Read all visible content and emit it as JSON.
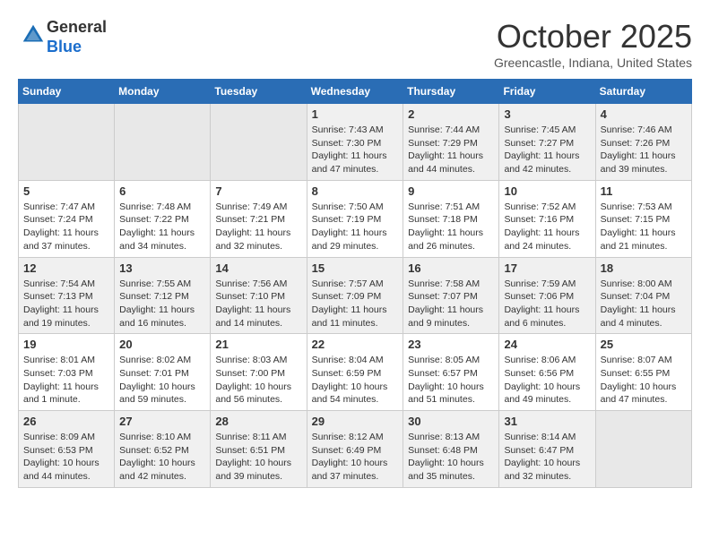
{
  "header": {
    "logo_line1": "General",
    "logo_line2": "Blue",
    "month": "October 2025",
    "location": "Greencastle, Indiana, United States"
  },
  "weekdays": [
    "Sunday",
    "Monday",
    "Tuesday",
    "Wednesday",
    "Thursday",
    "Friday",
    "Saturday"
  ],
  "weeks": [
    [
      {
        "day": "",
        "info": ""
      },
      {
        "day": "",
        "info": ""
      },
      {
        "day": "",
        "info": ""
      },
      {
        "day": "1",
        "info": "Sunrise: 7:43 AM\nSunset: 7:30 PM\nDaylight: 11 hours\nand 47 minutes."
      },
      {
        "day": "2",
        "info": "Sunrise: 7:44 AM\nSunset: 7:29 PM\nDaylight: 11 hours\nand 44 minutes."
      },
      {
        "day": "3",
        "info": "Sunrise: 7:45 AM\nSunset: 7:27 PM\nDaylight: 11 hours\nand 42 minutes."
      },
      {
        "day": "4",
        "info": "Sunrise: 7:46 AM\nSunset: 7:26 PM\nDaylight: 11 hours\nand 39 minutes."
      }
    ],
    [
      {
        "day": "5",
        "info": "Sunrise: 7:47 AM\nSunset: 7:24 PM\nDaylight: 11 hours\nand 37 minutes."
      },
      {
        "day": "6",
        "info": "Sunrise: 7:48 AM\nSunset: 7:22 PM\nDaylight: 11 hours\nand 34 minutes."
      },
      {
        "day": "7",
        "info": "Sunrise: 7:49 AM\nSunset: 7:21 PM\nDaylight: 11 hours\nand 32 minutes."
      },
      {
        "day": "8",
        "info": "Sunrise: 7:50 AM\nSunset: 7:19 PM\nDaylight: 11 hours\nand 29 minutes."
      },
      {
        "day": "9",
        "info": "Sunrise: 7:51 AM\nSunset: 7:18 PM\nDaylight: 11 hours\nand 26 minutes."
      },
      {
        "day": "10",
        "info": "Sunrise: 7:52 AM\nSunset: 7:16 PM\nDaylight: 11 hours\nand 24 minutes."
      },
      {
        "day": "11",
        "info": "Sunrise: 7:53 AM\nSunset: 7:15 PM\nDaylight: 11 hours\nand 21 minutes."
      }
    ],
    [
      {
        "day": "12",
        "info": "Sunrise: 7:54 AM\nSunset: 7:13 PM\nDaylight: 11 hours\nand 19 minutes."
      },
      {
        "day": "13",
        "info": "Sunrise: 7:55 AM\nSunset: 7:12 PM\nDaylight: 11 hours\nand 16 minutes."
      },
      {
        "day": "14",
        "info": "Sunrise: 7:56 AM\nSunset: 7:10 PM\nDaylight: 11 hours\nand 14 minutes."
      },
      {
        "day": "15",
        "info": "Sunrise: 7:57 AM\nSunset: 7:09 PM\nDaylight: 11 hours\nand 11 minutes."
      },
      {
        "day": "16",
        "info": "Sunrise: 7:58 AM\nSunset: 7:07 PM\nDaylight: 11 hours\nand 9 minutes."
      },
      {
        "day": "17",
        "info": "Sunrise: 7:59 AM\nSunset: 7:06 PM\nDaylight: 11 hours\nand 6 minutes."
      },
      {
        "day": "18",
        "info": "Sunrise: 8:00 AM\nSunset: 7:04 PM\nDaylight: 11 hours\nand 4 minutes."
      }
    ],
    [
      {
        "day": "19",
        "info": "Sunrise: 8:01 AM\nSunset: 7:03 PM\nDaylight: 11 hours\nand 1 minute."
      },
      {
        "day": "20",
        "info": "Sunrise: 8:02 AM\nSunset: 7:01 PM\nDaylight: 10 hours\nand 59 minutes."
      },
      {
        "day": "21",
        "info": "Sunrise: 8:03 AM\nSunset: 7:00 PM\nDaylight: 10 hours\nand 56 minutes."
      },
      {
        "day": "22",
        "info": "Sunrise: 8:04 AM\nSunset: 6:59 PM\nDaylight: 10 hours\nand 54 minutes."
      },
      {
        "day": "23",
        "info": "Sunrise: 8:05 AM\nSunset: 6:57 PM\nDaylight: 10 hours\nand 51 minutes."
      },
      {
        "day": "24",
        "info": "Sunrise: 8:06 AM\nSunset: 6:56 PM\nDaylight: 10 hours\nand 49 minutes."
      },
      {
        "day": "25",
        "info": "Sunrise: 8:07 AM\nSunset: 6:55 PM\nDaylight: 10 hours\nand 47 minutes."
      }
    ],
    [
      {
        "day": "26",
        "info": "Sunrise: 8:09 AM\nSunset: 6:53 PM\nDaylight: 10 hours\nand 44 minutes."
      },
      {
        "day": "27",
        "info": "Sunrise: 8:10 AM\nSunset: 6:52 PM\nDaylight: 10 hours\nand 42 minutes."
      },
      {
        "day": "28",
        "info": "Sunrise: 8:11 AM\nSunset: 6:51 PM\nDaylight: 10 hours\nand 39 minutes."
      },
      {
        "day": "29",
        "info": "Sunrise: 8:12 AM\nSunset: 6:49 PM\nDaylight: 10 hours\nand 37 minutes."
      },
      {
        "day": "30",
        "info": "Sunrise: 8:13 AM\nSunset: 6:48 PM\nDaylight: 10 hours\nand 35 minutes."
      },
      {
        "day": "31",
        "info": "Sunrise: 8:14 AM\nSunset: 6:47 PM\nDaylight: 10 hours\nand 32 minutes."
      },
      {
        "day": "",
        "info": ""
      }
    ]
  ]
}
